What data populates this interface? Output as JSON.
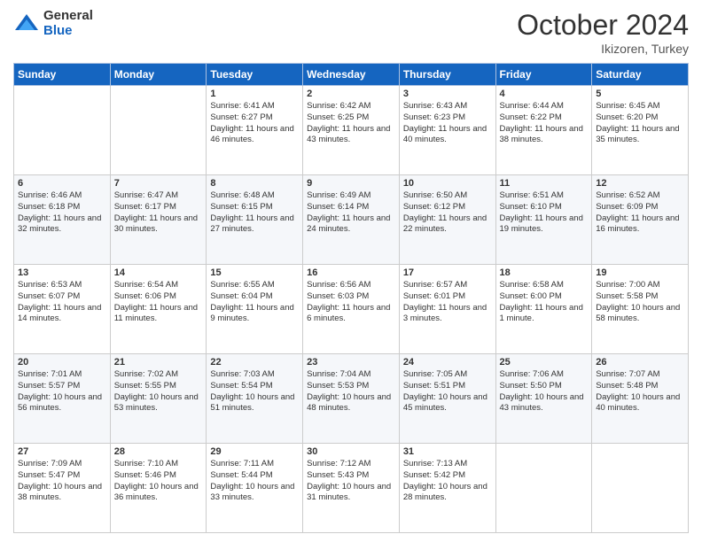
{
  "header": {
    "logo_general": "General",
    "logo_blue": "Blue",
    "month_title": "October 2024",
    "location": "Ikizoren, Turkey"
  },
  "days_of_week": [
    "Sunday",
    "Monday",
    "Tuesday",
    "Wednesday",
    "Thursday",
    "Friday",
    "Saturday"
  ],
  "weeks": [
    [
      {
        "day": "",
        "info": ""
      },
      {
        "day": "",
        "info": ""
      },
      {
        "day": "1",
        "info": "Sunrise: 6:41 AM\nSunset: 6:27 PM\nDaylight: 11 hours and 46 minutes."
      },
      {
        "day": "2",
        "info": "Sunrise: 6:42 AM\nSunset: 6:25 PM\nDaylight: 11 hours and 43 minutes."
      },
      {
        "day": "3",
        "info": "Sunrise: 6:43 AM\nSunset: 6:23 PM\nDaylight: 11 hours and 40 minutes."
      },
      {
        "day": "4",
        "info": "Sunrise: 6:44 AM\nSunset: 6:22 PM\nDaylight: 11 hours and 38 minutes."
      },
      {
        "day": "5",
        "info": "Sunrise: 6:45 AM\nSunset: 6:20 PM\nDaylight: 11 hours and 35 minutes."
      }
    ],
    [
      {
        "day": "6",
        "info": "Sunrise: 6:46 AM\nSunset: 6:18 PM\nDaylight: 11 hours and 32 minutes."
      },
      {
        "day": "7",
        "info": "Sunrise: 6:47 AM\nSunset: 6:17 PM\nDaylight: 11 hours and 30 minutes."
      },
      {
        "day": "8",
        "info": "Sunrise: 6:48 AM\nSunset: 6:15 PM\nDaylight: 11 hours and 27 minutes."
      },
      {
        "day": "9",
        "info": "Sunrise: 6:49 AM\nSunset: 6:14 PM\nDaylight: 11 hours and 24 minutes."
      },
      {
        "day": "10",
        "info": "Sunrise: 6:50 AM\nSunset: 6:12 PM\nDaylight: 11 hours and 22 minutes."
      },
      {
        "day": "11",
        "info": "Sunrise: 6:51 AM\nSunset: 6:10 PM\nDaylight: 11 hours and 19 minutes."
      },
      {
        "day": "12",
        "info": "Sunrise: 6:52 AM\nSunset: 6:09 PM\nDaylight: 11 hours and 16 minutes."
      }
    ],
    [
      {
        "day": "13",
        "info": "Sunrise: 6:53 AM\nSunset: 6:07 PM\nDaylight: 11 hours and 14 minutes."
      },
      {
        "day": "14",
        "info": "Sunrise: 6:54 AM\nSunset: 6:06 PM\nDaylight: 11 hours and 11 minutes."
      },
      {
        "day": "15",
        "info": "Sunrise: 6:55 AM\nSunset: 6:04 PM\nDaylight: 11 hours and 9 minutes."
      },
      {
        "day": "16",
        "info": "Sunrise: 6:56 AM\nSunset: 6:03 PM\nDaylight: 11 hours and 6 minutes."
      },
      {
        "day": "17",
        "info": "Sunrise: 6:57 AM\nSunset: 6:01 PM\nDaylight: 11 hours and 3 minutes."
      },
      {
        "day": "18",
        "info": "Sunrise: 6:58 AM\nSunset: 6:00 PM\nDaylight: 11 hours and 1 minute."
      },
      {
        "day": "19",
        "info": "Sunrise: 7:00 AM\nSunset: 5:58 PM\nDaylight: 10 hours and 58 minutes."
      }
    ],
    [
      {
        "day": "20",
        "info": "Sunrise: 7:01 AM\nSunset: 5:57 PM\nDaylight: 10 hours and 56 minutes."
      },
      {
        "day": "21",
        "info": "Sunrise: 7:02 AM\nSunset: 5:55 PM\nDaylight: 10 hours and 53 minutes."
      },
      {
        "day": "22",
        "info": "Sunrise: 7:03 AM\nSunset: 5:54 PM\nDaylight: 10 hours and 51 minutes."
      },
      {
        "day": "23",
        "info": "Sunrise: 7:04 AM\nSunset: 5:53 PM\nDaylight: 10 hours and 48 minutes."
      },
      {
        "day": "24",
        "info": "Sunrise: 7:05 AM\nSunset: 5:51 PM\nDaylight: 10 hours and 45 minutes."
      },
      {
        "day": "25",
        "info": "Sunrise: 7:06 AM\nSunset: 5:50 PM\nDaylight: 10 hours and 43 minutes."
      },
      {
        "day": "26",
        "info": "Sunrise: 7:07 AM\nSunset: 5:48 PM\nDaylight: 10 hours and 40 minutes."
      }
    ],
    [
      {
        "day": "27",
        "info": "Sunrise: 7:09 AM\nSunset: 5:47 PM\nDaylight: 10 hours and 38 minutes."
      },
      {
        "day": "28",
        "info": "Sunrise: 7:10 AM\nSunset: 5:46 PM\nDaylight: 10 hours and 36 minutes."
      },
      {
        "day": "29",
        "info": "Sunrise: 7:11 AM\nSunset: 5:44 PM\nDaylight: 10 hours and 33 minutes."
      },
      {
        "day": "30",
        "info": "Sunrise: 7:12 AM\nSunset: 5:43 PM\nDaylight: 10 hours and 31 minutes."
      },
      {
        "day": "31",
        "info": "Sunrise: 7:13 AM\nSunset: 5:42 PM\nDaylight: 10 hours and 28 minutes."
      },
      {
        "day": "",
        "info": ""
      },
      {
        "day": "",
        "info": ""
      }
    ]
  ]
}
